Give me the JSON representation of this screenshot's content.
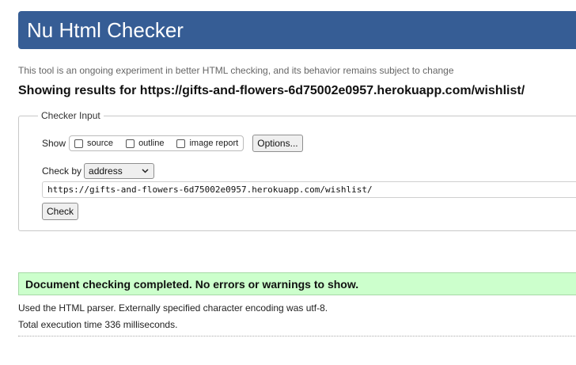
{
  "header": {
    "title": "Nu Html Checker"
  },
  "intro": {
    "subtitle": "This tool is an ongoing experiment in better HTML checking, and its behavior remains subject to change",
    "results_heading": "Showing results for https://gifts-and-flowers-6d75002e0957.herokuapp.com/wishlist/"
  },
  "checker_input": {
    "legend": "Checker Input",
    "show_label": "Show",
    "options": [
      {
        "label": "source",
        "checked": false
      },
      {
        "label": "outline",
        "checked": false
      },
      {
        "label": "image report",
        "checked": false
      }
    ],
    "options_button": "Options...",
    "check_by_label": "Check by",
    "check_by_value": "address",
    "url_value": "https://gifts-and-flowers-6d75002e0957.herokuapp.com/wishlist/",
    "check_button": "Check"
  },
  "results": {
    "success_message": "Document checking completed. No errors or warnings to show.",
    "parser_info": "Used the HTML parser. Externally specified character encoding was utf-8.",
    "execution_time": "Total execution time 336 milliseconds."
  },
  "colors": {
    "banner": "#365d95",
    "success_bg": "#ccffcc"
  }
}
